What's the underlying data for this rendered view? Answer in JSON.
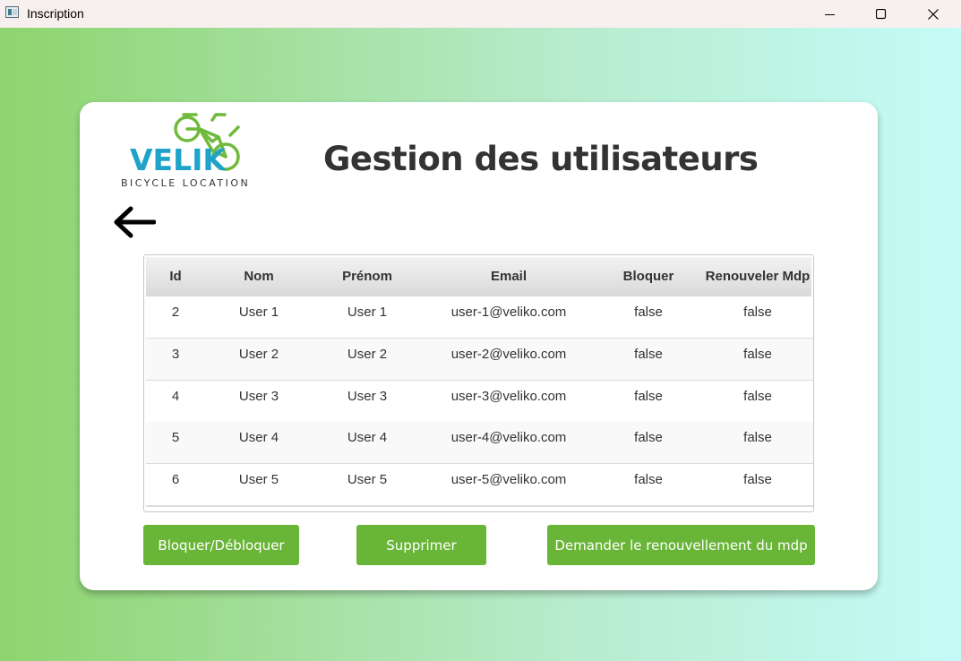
{
  "window": {
    "title": "Inscription"
  },
  "brand": {
    "name": "VELIK",
    "tagline": "BICYCLE LOCATION",
    "green": "#6fba3c",
    "blue": "#1fa3c8"
  },
  "page": {
    "title": "Gestion des utilisateurs"
  },
  "table": {
    "columns": [
      "Id",
      "Nom",
      "Prénom",
      "Email",
      "Bloquer",
      "Renouveler Mdp"
    ],
    "rows": [
      [
        "2",
        "User 1",
        "User 1",
        "user-1@veliko.com",
        "false",
        "false"
      ],
      [
        "3",
        "User 2",
        "User 2",
        "user-2@veliko.com",
        "false",
        "false"
      ],
      [
        "4",
        "User 3",
        "User 3",
        "user-3@veliko.com",
        "false",
        "false"
      ],
      [
        "5",
        "User 4",
        "User 4",
        "user-4@veliko.com",
        "false",
        "false"
      ],
      [
        "6",
        "User 5",
        "User 5",
        "user-5@veliko.com",
        "false",
        "false"
      ]
    ]
  },
  "actions": {
    "block_label": "Bloquer/Débloquer",
    "delete_label": "Supprimer",
    "renew_label": "Demander le renouvellement du mdp"
  },
  "colors": {
    "accent": "#69b537",
    "title_text": "#333333"
  }
}
